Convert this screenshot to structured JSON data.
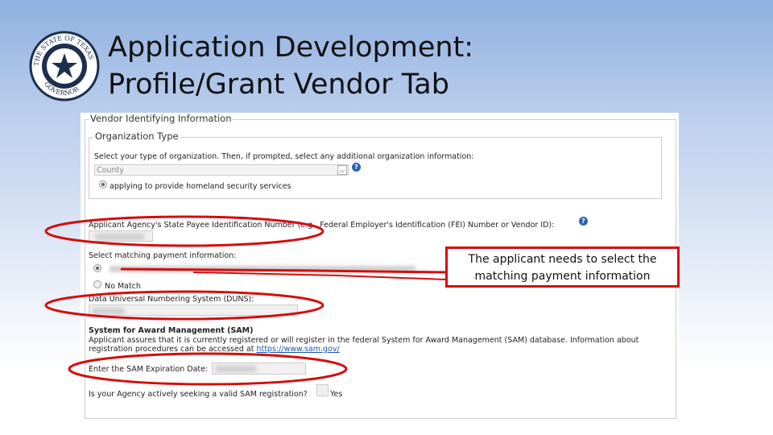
{
  "slide": {
    "title_line1": "Application Development:",
    "title_line2": "Profile/Grant Vendor Tab",
    "seal_text": "THE STATE OF TEXAS GOVERNOR"
  },
  "form": {
    "section_title": "Vendor Identifying Information",
    "org_type_legend": "Organization Type",
    "org_type_prompt": "Select your type of organization. Then, if prompted, select any additional organization information:",
    "org_type_value": "County",
    "org_radio_label": "applying to provide homeland security services",
    "payee_label": "Applicant Agency's State Payee Identification Number (e.g., Federal Employer's Identification (FEI) Number or Vendor ID):",
    "payment_label": "Select matching payment information:",
    "no_match_label": "No Match",
    "duns_label": "Data Universal Numbering System (DUNS):",
    "sam_heading": "System for Award Management (SAM)",
    "sam_text1": "Applicant assures that it is currently registered or will register in the federal System for Award Management (SAM) database. Information about",
    "sam_text2": "registration procedures can be accessed at ",
    "sam_link": "https://www.sam.gov/",
    "sam_date_label": "Enter the SAM Expiration Date:",
    "sam_seeking_label": "Is your Agency actively seeking a valid SAM registration?",
    "yes_label": "Yes",
    "help_glyph": "?"
  },
  "callout": {
    "text_line1": "The applicant needs to select the",
    "text_line2": "matching payment information"
  },
  "colors": {
    "annotation": "#d40d0d",
    "link": "#1a55b0"
  }
}
